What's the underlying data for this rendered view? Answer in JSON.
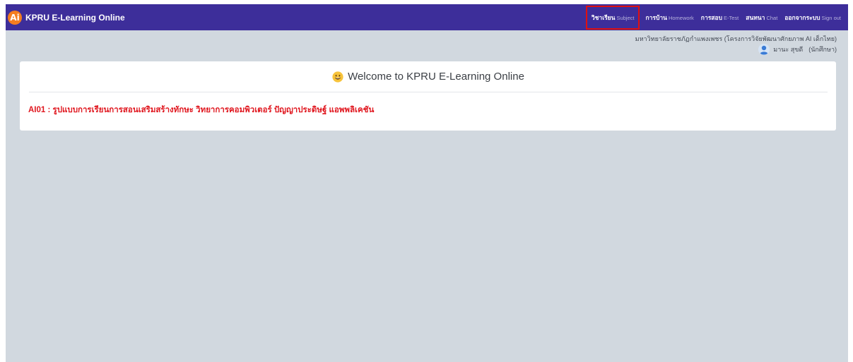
{
  "navbar": {
    "brand_logo": "Ai",
    "brand_title": "KPRU E-Learning Online",
    "items": [
      {
        "th": "วิชาเรียน",
        "en": "Subject",
        "active": true
      },
      {
        "th": "การบ้าน",
        "en": "Homework",
        "active": false
      },
      {
        "th": "การสอบ",
        "en": "E-Test",
        "active": false
      },
      {
        "th": "สนทนา",
        "en": "Chat",
        "active": false
      },
      {
        "th": "ออกจากระบบ",
        "en": "Sign out",
        "active": false
      }
    ]
  },
  "header": {
    "org": "มหาวิทยาลัยราชภัฏกำแพงเพชร (โครงการวิจัยพัฒนาศักยภาพ AI เด็กไทย)",
    "user_name": "มานะ สุขดี",
    "user_role": "(นักศึกษา)",
    "avatar_icon": "user-avatar-icon"
  },
  "card": {
    "welcome_icon": "grinning-face-icon",
    "welcome": "Welcome to KPRU E-Learning Online",
    "course": "AI01 : รูปแบบการเรียนการสอนเสริมสร้างทักษะ วิทยาการคอมพิวเตอร์ ปัญญาประดิษฐ์ แอพพลิเคชัน"
  },
  "colors": {
    "navbar": "#3d2e9a",
    "logo": "#f47d20",
    "background": "#d1d8df",
    "course_link": "#e0161e",
    "highlight": "#e01010"
  }
}
